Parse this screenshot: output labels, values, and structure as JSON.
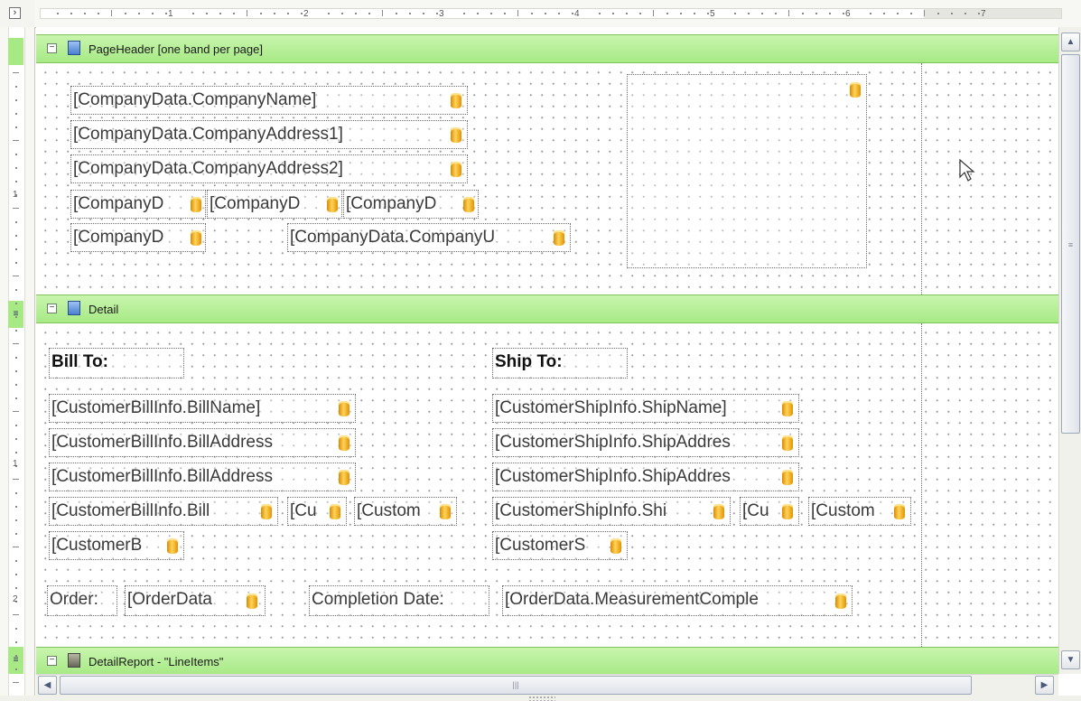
{
  "ruler": {
    "numbers": [
      "1",
      "2",
      "3",
      "4",
      "5",
      "6",
      "7"
    ],
    "left_numbers": [
      "1",
      "1",
      "2"
    ]
  },
  "bands": {
    "page_header": {
      "label": "PageHeader [one band per page]",
      "icon": "page-header-band-icon"
    },
    "detail": {
      "label": "Detail",
      "icon": "detail-band-icon"
    },
    "detail_report": {
      "label": "DetailReport - \"LineItems\"",
      "icon": "detail-report-band-icon"
    }
  },
  "page_header_fields": {
    "company_name": "[CompanyData.CompanyName]",
    "address1": "[CompanyData.CompanyAddress1]",
    "address2": "[CompanyData.CompanyAddress2]",
    "city": "[CompanyD",
    "state": "[CompanyD",
    "zip": "[CompanyD",
    "phone": "[CompanyD",
    "url": "[CompanyData.CompanyU"
  },
  "detail_fields": {
    "bill_to_label": "Bill To:",
    "ship_to_label": "Ship To:",
    "bill_name": "[CustomerBillInfo.BillName]",
    "bill_address1": "[CustomerBillInfo.BillAddress",
    "bill_address2": "[CustomerBillInfo.BillAddress",
    "bill_city": "[CustomerBillInfo.Bill",
    "bill_state": "[Cu",
    "bill_zip": "[Custom",
    "bill_phone": "[CustomerB",
    "ship_name": "[CustomerShipInfo.ShipName]",
    "ship_address1": "[CustomerShipInfo.ShipAddres",
    "ship_address2": "[CustomerShipInfo.ShipAddres",
    "ship_city": "[CustomerShipInfo.Shi",
    "ship_state": "[Cu",
    "ship_zip": "[Custom",
    "ship_phone": "[CustomerS",
    "order_label": "Order:",
    "order_value": "[OrderData",
    "completion_label": "Completion Date:",
    "completion_value": "[OrderData.MeasurementComple"
  },
  "colors": {
    "band_green": "#a7e985",
    "field_icon": "#f0a800"
  },
  "icons": {
    "corner": "expand-icon",
    "collapse": "collapse-icon",
    "scroll_up": "scroll-up-icon",
    "scroll_down": "scroll-down-icon",
    "scroll_left": "scroll-left-icon",
    "scroll_right": "scroll-right-icon",
    "cursor": "mouse-cursor-icon",
    "field": "database-field-icon"
  }
}
